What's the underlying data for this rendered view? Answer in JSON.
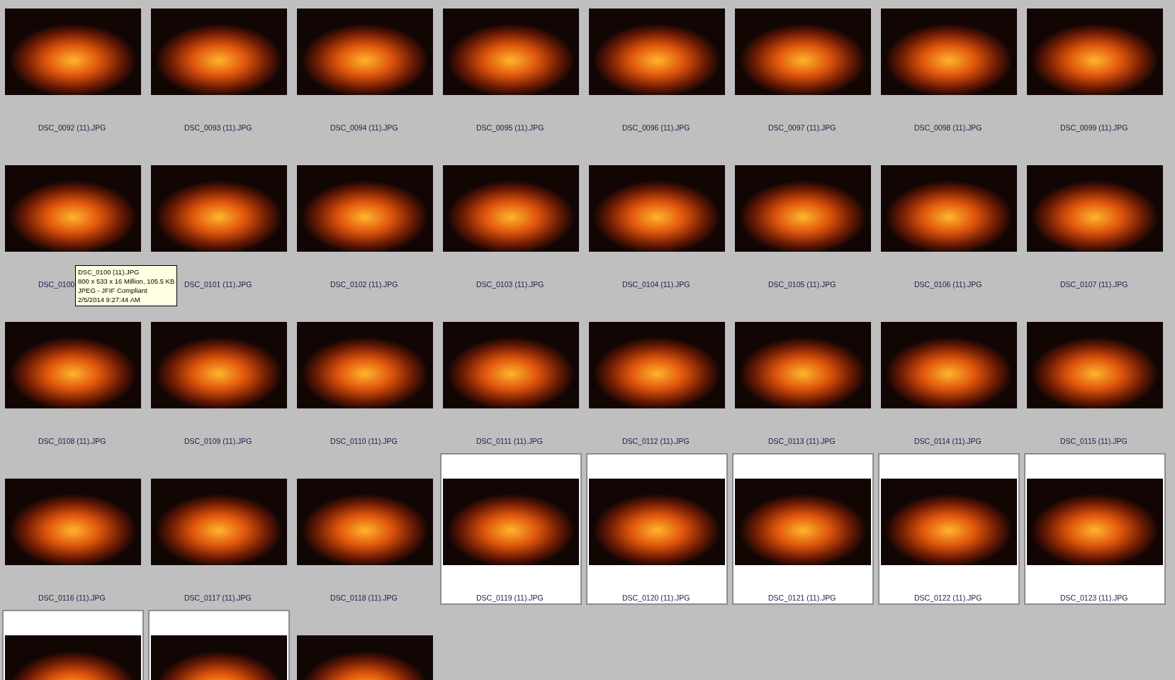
{
  "items": [
    {
      "name": "DSC_0092 (11).JPG",
      "selected": false
    },
    {
      "name": "DSC_0093 (11).JPG",
      "selected": false
    },
    {
      "name": "DSC_0094 (11).JPG",
      "selected": false
    },
    {
      "name": "DSC_0095 (11).JPG",
      "selected": false
    },
    {
      "name": "DSC_0096 (11).JPG",
      "selected": false
    },
    {
      "name": "DSC_0097 (11).JPG",
      "selected": false
    },
    {
      "name": "DSC_0098 (11).JPG",
      "selected": false
    },
    {
      "name": "DSC_0099 (11).JPG",
      "selected": false
    },
    {
      "name": "DSC_0100",
      "selected": false
    },
    {
      "name": "DSC_0101 (11).JPG",
      "selected": false
    },
    {
      "name": "DSC_0102 (11).JPG",
      "selected": false
    },
    {
      "name": "DSC_0103 (11).JPG",
      "selected": false
    },
    {
      "name": "DSC_0104 (11).JPG",
      "selected": false
    },
    {
      "name": "DSC_0105 (11).JPG",
      "selected": false
    },
    {
      "name": "DSC_0106 (11).JPG",
      "selected": false
    },
    {
      "name": "DSC_0107 (11).JPG",
      "selected": false
    },
    {
      "name": "DSC_0108 (11).JPG",
      "selected": false
    },
    {
      "name": "DSC_0109 (11).JPG",
      "selected": false
    },
    {
      "name": "DSC_0110 (11).JPG",
      "selected": false
    },
    {
      "name": "DSC_0111 (11).JPG",
      "selected": false
    },
    {
      "name": "DSC_0112 (11).JPG",
      "selected": false
    },
    {
      "name": "DSC_0113 (11).JPG",
      "selected": false
    },
    {
      "name": "DSC_0114 (11).JPG",
      "selected": false
    },
    {
      "name": "DSC_0115 (11).JPG",
      "selected": false
    },
    {
      "name": "DSC_0116 (11).JPG",
      "selected": false
    },
    {
      "name": "DSC_0117 (11).JPG",
      "selected": false
    },
    {
      "name": "DSC_0118 (11).JPG",
      "selected": false
    },
    {
      "name": "DSC_0119 (11).JPG",
      "selected": true
    },
    {
      "name": "DSC_0120 (11).JPG",
      "selected": true
    },
    {
      "name": "DSC_0121 (11).JPG",
      "selected": true
    },
    {
      "name": "DSC_0122 (11).JPG",
      "selected": true
    },
    {
      "name": "DSC_0123 (11).JPG",
      "selected": true
    },
    {
      "selected": true
    },
    {
      "selected": true
    },
    {
      "selected": false
    }
  ],
  "tooltip": {
    "lines": [
      "DSC_0100 (11).JPG",
      "800 x 533 x 16 Million, 105.5 KB",
      "JPEG - JFIF Compliant",
      "2/5/2014 9:27:44 AM"
    ]
  }
}
